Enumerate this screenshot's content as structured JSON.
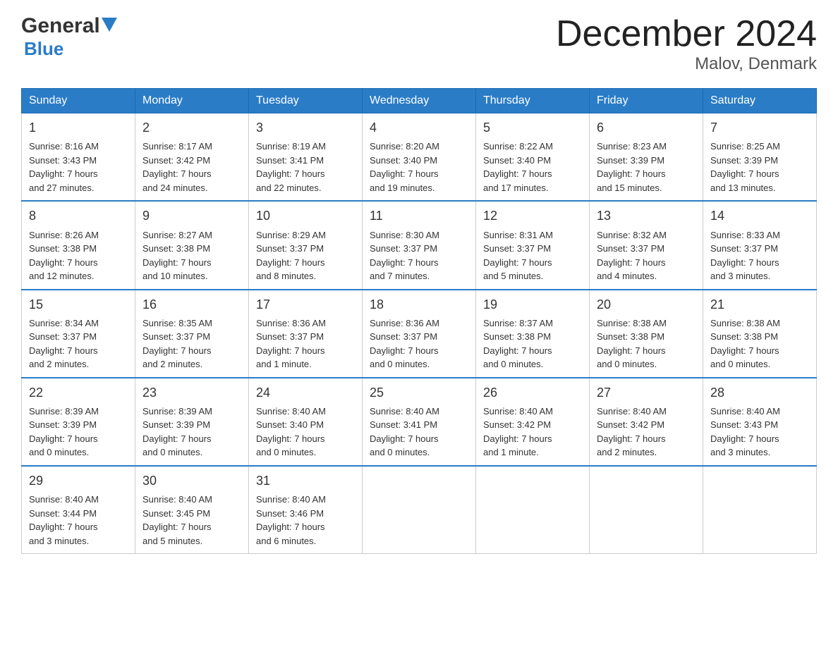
{
  "header": {
    "logo_general": "General",
    "logo_blue": "Blue",
    "title": "December 2024",
    "subtitle": "Malov, Denmark"
  },
  "days_of_week": [
    "Sunday",
    "Monday",
    "Tuesday",
    "Wednesday",
    "Thursday",
    "Friday",
    "Saturday"
  ],
  "weeks": [
    [
      {
        "day": "1",
        "sunrise": "8:16 AM",
        "sunset": "3:43 PM",
        "daylight_hours": "7",
        "daylight_minutes": "27"
      },
      {
        "day": "2",
        "sunrise": "8:17 AM",
        "sunset": "3:42 PM",
        "daylight_hours": "7",
        "daylight_minutes": "24"
      },
      {
        "day": "3",
        "sunrise": "8:19 AM",
        "sunset": "3:41 PM",
        "daylight_hours": "7",
        "daylight_minutes": "22"
      },
      {
        "day": "4",
        "sunrise": "8:20 AM",
        "sunset": "3:40 PM",
        "daylight_hours": "7",
        "daylight_minutes": "19"
      },
      {
        "day": "5",
        "sunrise": "8:22 AM",
        "sunset": "3:40 PM",
        "daylight_hours": "7",
        "daylight_minutes": "17"
      },
      {
        "day": "6",
        "sunrise": "8:23 AM",
        "sunset": "3:39 PM",
        "daylight_hours": "7",
        "daylight_minutes": "15"
      },
      {
        "day": "7",
        "sunrise": "8:25 AM",
        "sunset": "3:39 PM",
        "daylight_hours": "7",
        "daylight_minutes": "13"
      }
    ],
    [
      {
        "day": "8",
        "sunrise": "8:26 AM",
        "sunset": "3:38 PM",
        "daylight_hours": "7",
        "daylight_minutes": "12"
      },
      {
        "day": "9",
        "sunrise": "8:27 AM",
        "sunset": "3:38 PM",
        "daylight_hours": "7",
        "daylight_minutes": "10"
      },
      {
        "day": "10",
        "sunrise": "8:29 AM",
        "sunset": "3:37 PM",
        "daylight_hours": "7",
        "daylight_minutes": "8"
      },
      {
        "day": "11",
        "sunrise": "8:30 AM",
        "sunset": "3:37 PM",
        "daylight_hours": "7",
        "daylight_minutes": "7"
      },
      {
        "day": "12",
        "sunrise": "8:31 AM",
        "sunset": "3:37 PM",
        "daylight_hours": "7",
        "daylight_minutes": "5"
      },
      {
        "day": "13",
        "sunrise": "8:32 AM",
        "sunset": "3:37 PM",
        "daylight_hours": "7",
        "daylight_minutes": "4"
      },
      {
        "day": "14",
        "sunrise": "8:33 AM",
        "sunset": "3:37 PM",
        "daylight_hours": "7",
        "daylight_minutes": "3"
      }
    ],
    [
      {
        "day": "15",
        "sunrise": "8:34 AM",
        "sunset": "3:37 PM",
        "daylight_hours": "7",
        "daylight_minutes": "2"
      },
      {
        "day": "16",
        "sunrise": "8:35 AM",
        "sunset": "3:37 PM",
        "daylight_hours": "7",
        "daylight_minutes": "2"
      },
      {
        "day": "17",
        "sunrise": "8:36 AM",
        "sunset": "3:37 PM",
        "daylight_hours": "7",
        "daylight_minutes": "1"
      },
      {
        "day": "18",
        "sunrise": "8:36 AM",
        "sunset": "3:37 PM",
        "daylight_hours": "7",
        "daylight_minutes": "0"
      },
      {
        "day": "19",
        "sunrise": "8:37 AM",
        "sunset": "3:38 PM",
        "daylight_hours": "7",
        "daylight_minutes": "0"
      },
      {
        "day": "20",
        "sunrise": "8:38 AM",
        "sunset": "3:38 PM",
        "daylight_hours": "7",
        "daylight_minutes": "0"
      },
      {
        "day": "21",
        "sunrise": "8:38 AM",
        "sunset": "3:38 PM",
        "daylight_hours": "7",
        "daylight_minutes": "0"
      }
    ],
    [
      {
        "day": "22",
        "sunrise": "8:39 AM",
        "sunset": "3:39 PM",
        "daylight_hours": "7",
        "daylight_minutes": "0"
      },
      {
        "day": "23",
        "sunrise": "8:39 AM",
        "sunset": "3:39 PM",
        "daylight_hours": "7",
        "daylight_minutes": "0"
      },
      {
        "day": "24",
        "sunrise": "8:40 AM",
        "sunset": "3:40 PM",
        "daylight_hours": "7",
        "daylight_minutes": "0"
      },
      {
        "day": "25",
        "sunrise": "8:40 AM",
        "sunset": "3:41 PM",
        "daylight_hours": "7",
        "daylight_minutes": "0"
      },
      {
        "day": "26",
        "sunrise": "8:40 AM",
        "sunset": "3:42 PM",
        "daylight_hours": "7",
        "daylight_minutes": "1"
      },
      {
        "day": "27",
        "sunrise": "8:40 AM",
        "sunset": "3:42 PM",
        "daylight_hours": "7",
        "daylight_minutes": "2"
      },
      {
        "day": "28",
        "sunrise": "8:40 AM",
        "sunset": "3:43 PM",
        "daylight_hours": "7",
        "daylight_minutes": "3"
      }
    ],
    [
      {
        "day": "29",
        "sunrise": "8:40 AM",
        "sunset": "3:44 PM",
        "daylight_hours": "7",
        "daylight_minutes": "3"
      },
      {
        "day": "30",
        "sunrise": "8:40 AM",
        "sunset": "3:45 PM",
        "daylight_hours": "7",
        "daylight_minutes": "5"
      },
      {
        "day": "31",
        "sunrise": "8:40 AM",
        "sunset": "3:46 PM",
        "daylight_hours": "7",
        "daylight_minutes": "6"
      },
      null,
      null,
      null,
      null
    ]
  ]
}
